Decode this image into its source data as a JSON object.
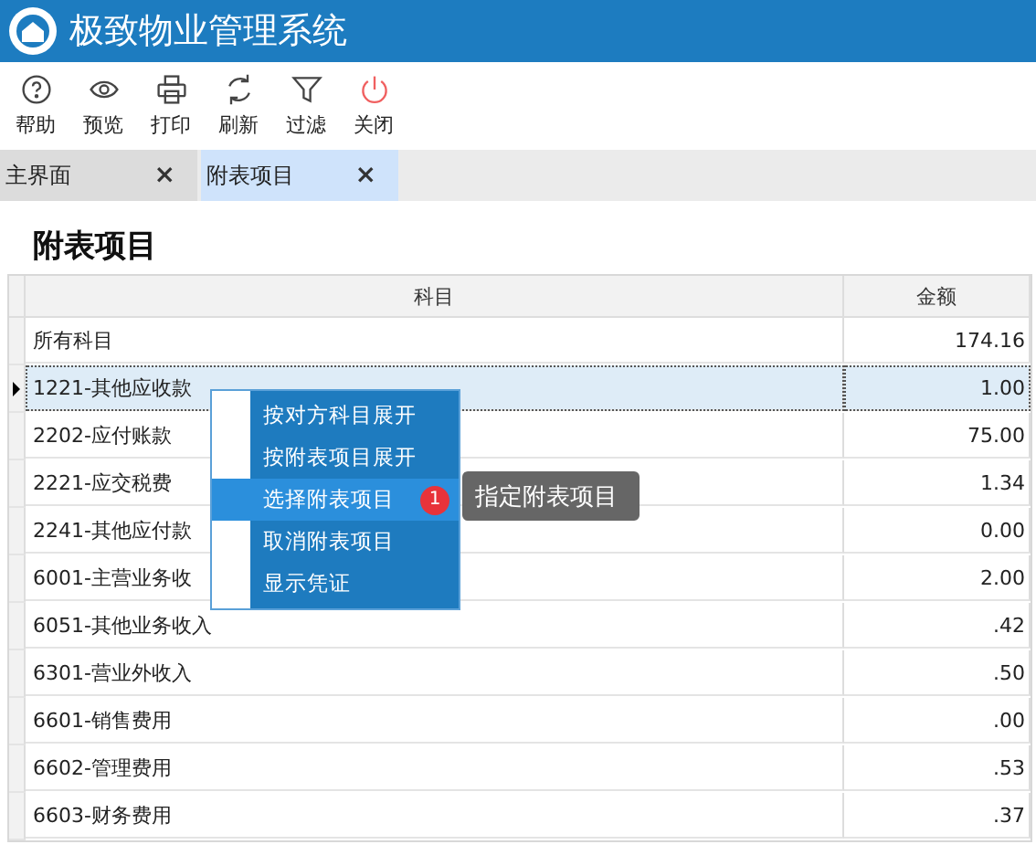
{
  "app": {
    "title": "极致物业管理系统"
  },
  "toolbar": [
    {
      "kind": "help",
      "label": "帮助"
    },
    {
      "kind": "preview",
      "label": "预览"
    },
    {
      "kind": "print",
      "label": "打印"
    },
    {
      "kind": "refresh",
      "label": "刷新"
    },
    {
      "kind": "filter",
      "label": "过滤"
    },
    {
      "kind": "power",
      "label": "关闭"
    }
  ],
  "tabs": [
    {
      "label": "主界面",
      "close": "×",
      "selected": false
    },
    {
      "label": "附表项目",
      "close": "×",
      "selected": true
    }
  ],
  "page_title": "附表项目",
  "table": {
    "columns": [
      "科目",
      "金额"
    ],
    "rows": [
      {
        "subject": "所有科目",
        "amount": "174.16",
        "selected": false
      },
      {
        "subject": "1221-其他应收款",
        "amount": "1.00",
        "selected": true
      },
      {
        "subject": "2202-应付账款",
        "amount": "75.00",
        "selected": false
      },
      {
        "subject": "2221-应交税费",
        "amount": "1.34",
        "selected": false
      },
      {
        "subject": "2241-其他应付款",
        "amount": "0.00",
        "selected": false
      },
      {
        "subject": "6001-主营业务收",
        "amount": "2.00",
        "selected": false
      },
      {
        "subject": "6051-其他业务收入",
        "amount": ".42",
        "selected": false
      },
      {
        "subject": "6301-营业外收入",
        "amount": ".50",
        "selected": false
      },
      {
        "subject": "6601-销售费用",
        "amount": ".00",
        "selected": false
      },
      {
        "subject": "6602-管理费用",
        "amount": ".53",
        "selected": false
      },
      {
        "subject": "6603-财务费用",
        "amount": ".37",
        "selected": false
      }
    ]
  },
  "context_menu": {
    "items": [
      {
        "label": "按对方科目展开",
        "selected": false
      },
      {
        "label": "按附表项目展开",
        "selected": false
      },
      {
        "label": "选择附表项目",
        "selected": true,
        "badge": "1"
      },
      {
        "label": "取消附表项目",
        "selected": false
      },
      {
        "label": "显示凭证",
        "selected": false
      }
    ]
  },
  "tooltip": "指定附表项目"
}
